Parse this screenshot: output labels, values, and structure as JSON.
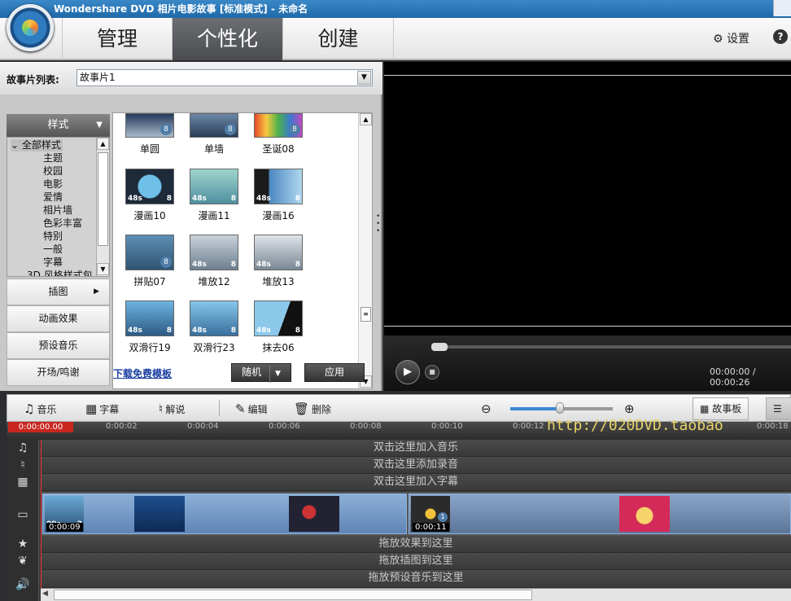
{
  "window": {
    "title": "Wondershare DVD 相片电影故事 [标准模式] - 未命名"
  },
  "nav": {
    "tabs": [
      {
        "label": "管理"
      },
      {
        "label": "个性化"
      },
      {
        "label": "创建"
      }
    ],
    "settings_label": "设置",
    "help_label": "?"
  },
  "story": {
    "label": "故事片列表:",
    "value": "故事片1"
  },
  "categories": {
    "style_header": "样式",
    "tree": [
      "全部样式",
      "主题",
      "校园",
      "电影",
      "爱情",
      "相片墙",
      "色彩丰富",
      "特别",
      "一般",
      "字幕",
      "3D 风格样式包"
    ],
    "buttons": [
      "插图",
      "动画效果",
      "预设音乐",
      "开场/鸣谢"
    ]
  },
  "gallery": {
    "items": [
      {
        "label": "单圆",
        "badge": "8"
      },
      {
        "label": "单墙",
        "badge": "8"
      },
      {
        "label": "圣诞08",
        "badge": "8"
      },
      {
        "label": "漫画10",
        "duration": "48s",
        "count": "8"
      },
      {
        "label": "漫画11",
        "duration": "48s",
        "count": "8"
      },
      {
        "label": "漫画16",
        "duration": "48s",
        "count": "8"
      },
      {
        "label": "拼贴07",
        "badge": "8"
      },
      {
        "label": "堆放12",
        "duration": "48s",
        "count": "8"
      },
      {
        "label": "堆放13",
        "duration": "48s",
        "count": "8"
      },
      {
        "label": "双滑行19",
        "duration": "48s",
        "count": "8"
      },
      {
        "label": "双滑行23",
        "duration": "48s",
        "count": "8"
      },
      {
        "label": "抹去06",
        "duration": "48s",
        "count": "8"
      }
    ],
    "download_link": "下载免费模板",
    "random_button": "随机",
    "apply_button": "应用"
  },
  "preview": {
    "time": "00:00:00 / 00:00:26"
  },
  "toolbar": {
    "music": "音乐",
    "subtitle": "字幕",
    "narration": "解说",
    "edit": "编辑",
    "delete": "删除",
    "storyboard": "故事板",
    "zoom_level": 0.48
  },
  "timeline": {
    "current": "0:00:00.00",
    "ticks": [
      "0:00:02",
      "0:00:04",
      "0:00:06",
      "0:00:08",
      "0:00:10",
      "0:00:12",
      "0:00:18"
    ],
    "watermark": "http://020DVD.taobao",
    "lanes": {
      "music": "双击这里加入音乐",
      "record": "双击这里添加录音",
      "subtitle": "双击这里加入字幕",
      "effect": "拖放效果到这里",
      "clipart": "拖放插图到这里",
      "preset_music": "拖放预设音乐到这里"
    },
    "clips": [
      {
        "time": "0:00:09",
        "corner_left": "09s",
        "corner_right": "2"
      },
      {
        "time": "0:00:11",
        "badge": "1"
      }
    ]
  }
}
